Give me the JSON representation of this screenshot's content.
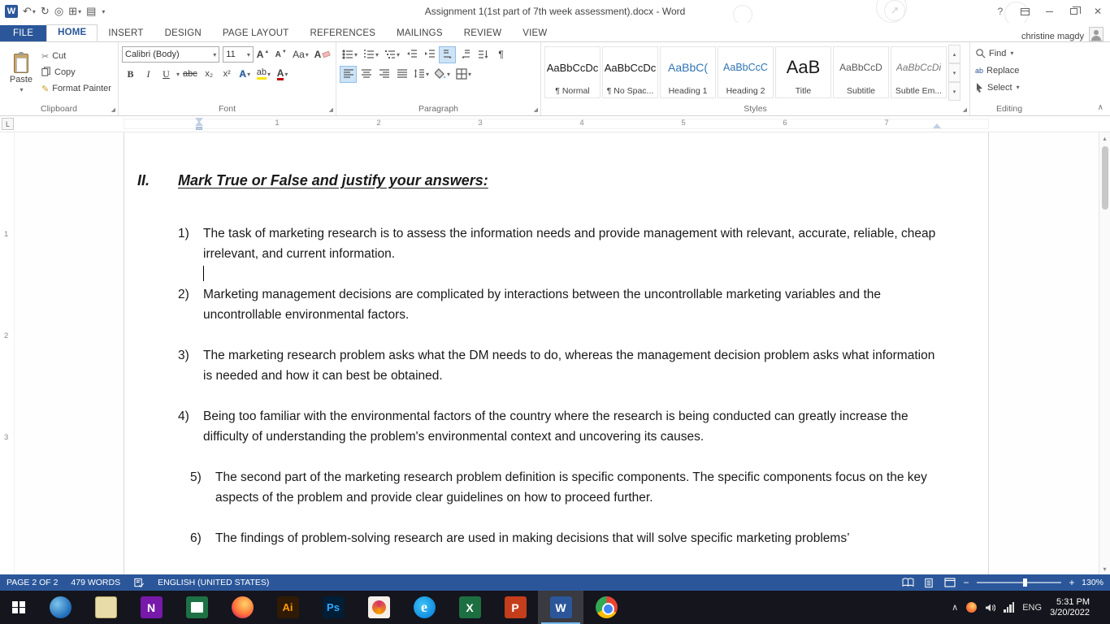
{
  "titlebar": {
    "title": "Assignment 1(1st part of 7th week assessment).docx - Word"
  },
  "tabs": [
    "FILE",
    "HOME",
    "INSERT",
    "DESIGN",
    "PAGE LAYOUT",
    "REFERENCES",
    "MAILINGS",
    "REVIEW",
    "VIEW"
  ],
  "user_name": "christine magdy",
  "ribbon": {
    "clipboard": {
      "label": "Clipboard",
      "paste": "Paste",
      "cut": "Cut",
      "copy": "Copy",
      "format_painter": "Format Painter"
    },
    "font": {
      "label": "Font",
      "font_name": "Calibri (Body)",
      "font_size": "11"
    },
    "paragraph": {
      "label": "Paragraph"
    },
    "styles": {
      "label": "Styles",
      "items": [
        {
          "sample": "AaBbCcDc",
          "name": "¶ Normal"
        },
        {
          "sample": "AaBbCcDc",
          "name": "¶ No Spac..."
        },
        {
          "sample": "AaBbC(",
          "name": "Heading 1"
        },
        {
          "sample": "AaBbCcC",
          "name": "Heading 2"
        },
        {
          "sample": "AaB",
          "name": "Title"
        },
        {
          "sample": "AaBbCcD",
          "name": "Subtitle"
        },
        {
          "sample": "AaBbCcDi",
          "name": "Subtle Em..."
        }
      ]
    },
    "editing": {
      "label": "Editing",
      "find": "Find",
      "replace": "Replace",
      "select": "Select"
    }
  },
  "ruler": {
    "h": [
      "1",
      "2",
      "3",
      "4",
      "5",
      "6",
      "7"
    ],
    "v": [
      "1",
      "2",
      "3"
    ]
  },
  "document": {
    "heading_num": "II.",
    "heading": "Mark True or False and justify your answers:",
    "items": [
      {
        "num": "1)",
        "text": "The task of marketing research is to assess the information needs and provide management with relevant, accurate, reliable, cheap irrelevant, and current information."
      },
      {
        "num": "2)",
        "text": "Marketing management decisions are complicated by interactions between the uncontrollable marketing variables and the uncontrollable environmental factors."
      },
      {
        "num": "3)",
        "text": "The marketing research problem asks what the DM needs to do, whereas the management decision problem asks what information is needed and how it can best be obtained."
      },
      {
        "num": "4)",
        "text": "Being too familiar with the environmental factors of the country where the research is being conducted can greatly increase the difficulty of understanding the problem's environmental context and uncovering its causes."
      },
      {
        "num": "5)",
        "text": "The second part of the marketing research problem definition is specific components. The specific components focus on the key aspects of the problem and provide clear guidelines on how to proceed further."
      },
      {
        "num": "6)",
        "text": "The findings of problem-solving research are used in making decisions that will solve specific marketing problems’"
      }
    ]
  },
  "statusbar": {
    "page": "PAGE 2 OF 2",
    "words": "479 WORDS",
    "language": "ENGLISH (UNITED STATES)",
    "zoom": "130%",
    "zoom_out": "−",
    "zoom_in": "+"
  },
  "taskbar": {
    "onenote_letter": "N",
    "illustrator_letter": "Ai",
    "photoshop_letter": "Ps",
    "edge_letter": "e",
    "excel_letter": "X",
    "powerpoint_letter": "P",
    "word_letter": "W",
    "tray_lang": "ENG",
    "time": "5:31 PM",
    "date": "3/20/2022"
  },
  "icons": {
    "dropdown": "▾",
    "undo": "↶",
    "redo": "↻",
    "save": "▤",
    "touch": "◎",
    "grid": "⊞",
    "help": "?",
    "close": "✕",
    "collapse": "∧",
    "scroll_up": "▴",
    "scroll_down": "▾",
    "deco_arrow": "↗",
    "cut": "✂",
    "format_painter": "✎",
    "bold": "B",
    "italic": "I",
    "underline": "U",
    "strike": "abc",
    "subscript": "x₂",
    "superscript": "x²",
    "letterA": "A",
    "case": "Aa",
    "highlight_ab": "ab",
    "up": "▲",
    "down": "▼",
    "pilcrow": "¶",
    "launcher": "◢",
    "tab_selector": "L",
    "replace_ab": "ab"
  }
}
